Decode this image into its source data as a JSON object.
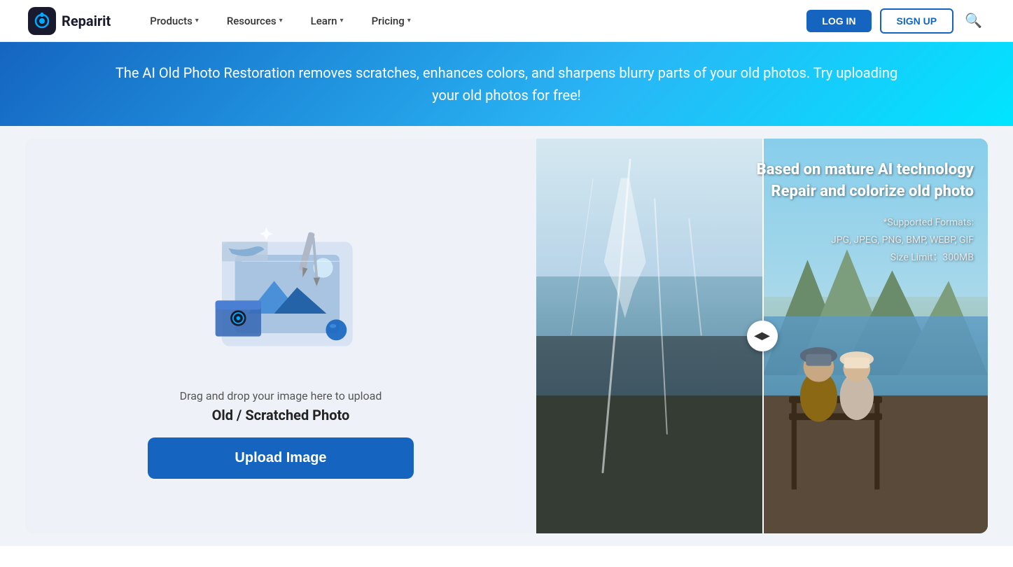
{
  "header": {
    "logo_text": "Repairit",
    "nav_items": [
      {
        "label": "Products",
        "has_dropdown": true
      },
      {
        "label": "Resources",
        "has_dropdown": true
      },
      {
        "label": "Learn",
        "has_dropdown": true
      },
      {
        "label": "Pricing",
        "has_dropdown": true
      }
    ],
    "btn_login": "LOG IN",
    "btn_signup": "SIGN UP"
  },
  "banner": {
    "text_line1": "The AI Old Photo Restoration removes scratches, enhances colors, and sharpens blurry parts of your old photos. Try uploading",
    "text_line2": "your old photos for free!"
  },
  "left_panel": {
    "drag_text": "Drag and drop your image here to upload",
    "photo_type": "Old / Scratched Photo",
    "upload_btn": "Upload Image"
  },
  "right_panel": {
    "overlay_title_line1": "Based on mature AI technology",
    "overlay_title_line2": "Repair and colorize old photo",
    "formats_label": "*Supported Formats:",
    "formats_list": "JPG, JPEG, PNG, BMP, WEBP, GIF",
    "size_limit": "Size Limit：300MB"
  }
}
